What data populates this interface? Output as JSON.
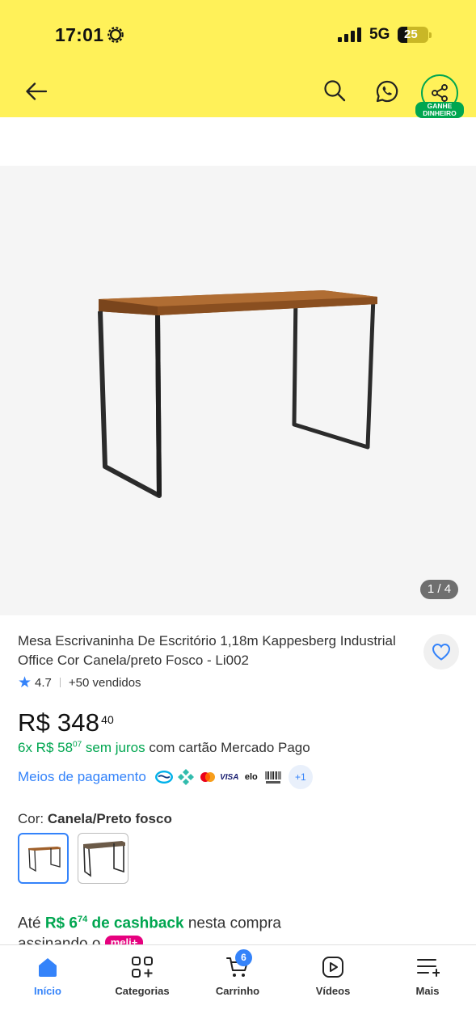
{
  "status_bar": {
    "time": "17:01",
    "network": "5G",
    "battery": "25"
  },
  "header": {
    "share_badge": "GANHE DINHEIRO",
    "icons": [
      "back-arrow-icon",
      "search-icon",
      "whatsapp-icon",
      "share-icon"
    ],
    "background": "#FFF159"
  },
  "gallery": {
    "counter": "1 / 4"
  },
  "product": {
    "title": "Mesa Escrivaninha De Escritório 1,18m Kappesberg Industrial Office Cor Canela/preto Fosco - Li002",
    "rating": "4.7",
    "sold": "+50 vendidos",
    "price_main": "R$ 348",
    "price_cents": "40",
    "installments": {
      "prefix": "6x R$ 58",
      "cents": "07",
      "no_interest": "sem juros",
      "suffix": "com cartão Mercado Pago"
    },
    "payment_link": "Meios de pagamento",
    "payment_more": "+1",
    "payment_brands": [
      "mercado-pago-icon",
      "pix-icon",
      "mastercard-icon",
      "visa-icon",
      "elo-icon",
      "boleto-icon"
    ],
    "color_label": "Cor:",
    "color_value": "Canela/Preto fosco",
    "cashback": {
      "prefix": "Até",
      "amount": "R$ 6",
      "cents": "74",
      "highlight": "de cashback",
      "suffix": "nesta compra",
      "line2": "assinando o",
      "meli": "meli+"
    }
  },
  "bottom_nav": {
    "items": [
      {
        "label": "Início",
        "icon": "home-icon",
        "active": true
      },
      {
        "label": "Categorias",
        "icon": "categories-icon",
        "active": false
      },
      {
        "label": "Carrinho",
        "icon": "cart-icon",
        "active": false,
        "badge": "6"
      },
      {
        "label": "Vídeos",
        "icon": "video-icon",
        "active": false
      },
      {
        "label": "Mais",
        "icon": "more-icon",
        "active": false
      }
    ]
  },
  "colors": {
    "accent": "#3483fa",
    "green": "#00a650",
    "yellow": "#FFF159",
    "meli": "#e6007e"
  }
}
